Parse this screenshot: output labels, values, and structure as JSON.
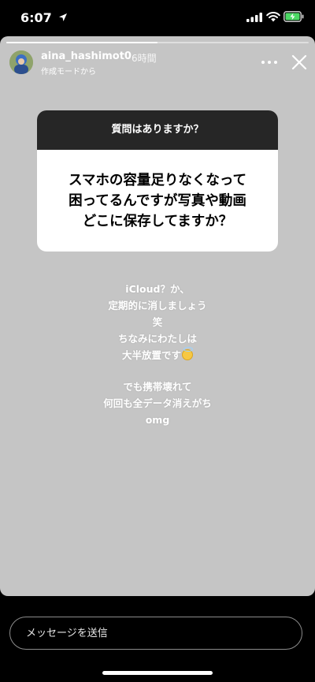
{
  "status_bar": {
    "time": "6:07",
    "icons": [
      "location-arrow-icon",
      "cellular-signal-icon",
      "wifi-icon",
      "battery-charging-icon"
    ]
  },
  "story": {
    "progress": 0.5,
    "username": "aina_hashimot0",
    "time_ago": "6時間",
    "subtitle": "作成モードから",
    "icons": [
      "avatar",
      "more-icon",
      "close-icon"
    ]
  },
  "question": {
    "header": "質問はありますか？",
    "lines": [
      "スマホの容量足りなくなって",
      "困ってるんですが写真や動画",
      "どこに保存してますか？"
    ]
  },
  "reply": {
    "lines_1": [
      "iCloud？か、",
      "定期的に消しましょう",
      "笑",
      "ちなみにわたしは",
      "大半放置です"
    ],
    "emoji": "smiling-face-with-halo",
    "lines_2": [
      "でも携帯壊れて",
      "何回も全データ消えがち",
      "omg"
    ]
  },
  "message": {
    "placeholder": "メッセージを送信"
  },
  "colors": {
    "story_bg": "#c5c5c5",
    "sticker_header": "#262626",
    "sticker_body": "#ffffff"
  }
}
